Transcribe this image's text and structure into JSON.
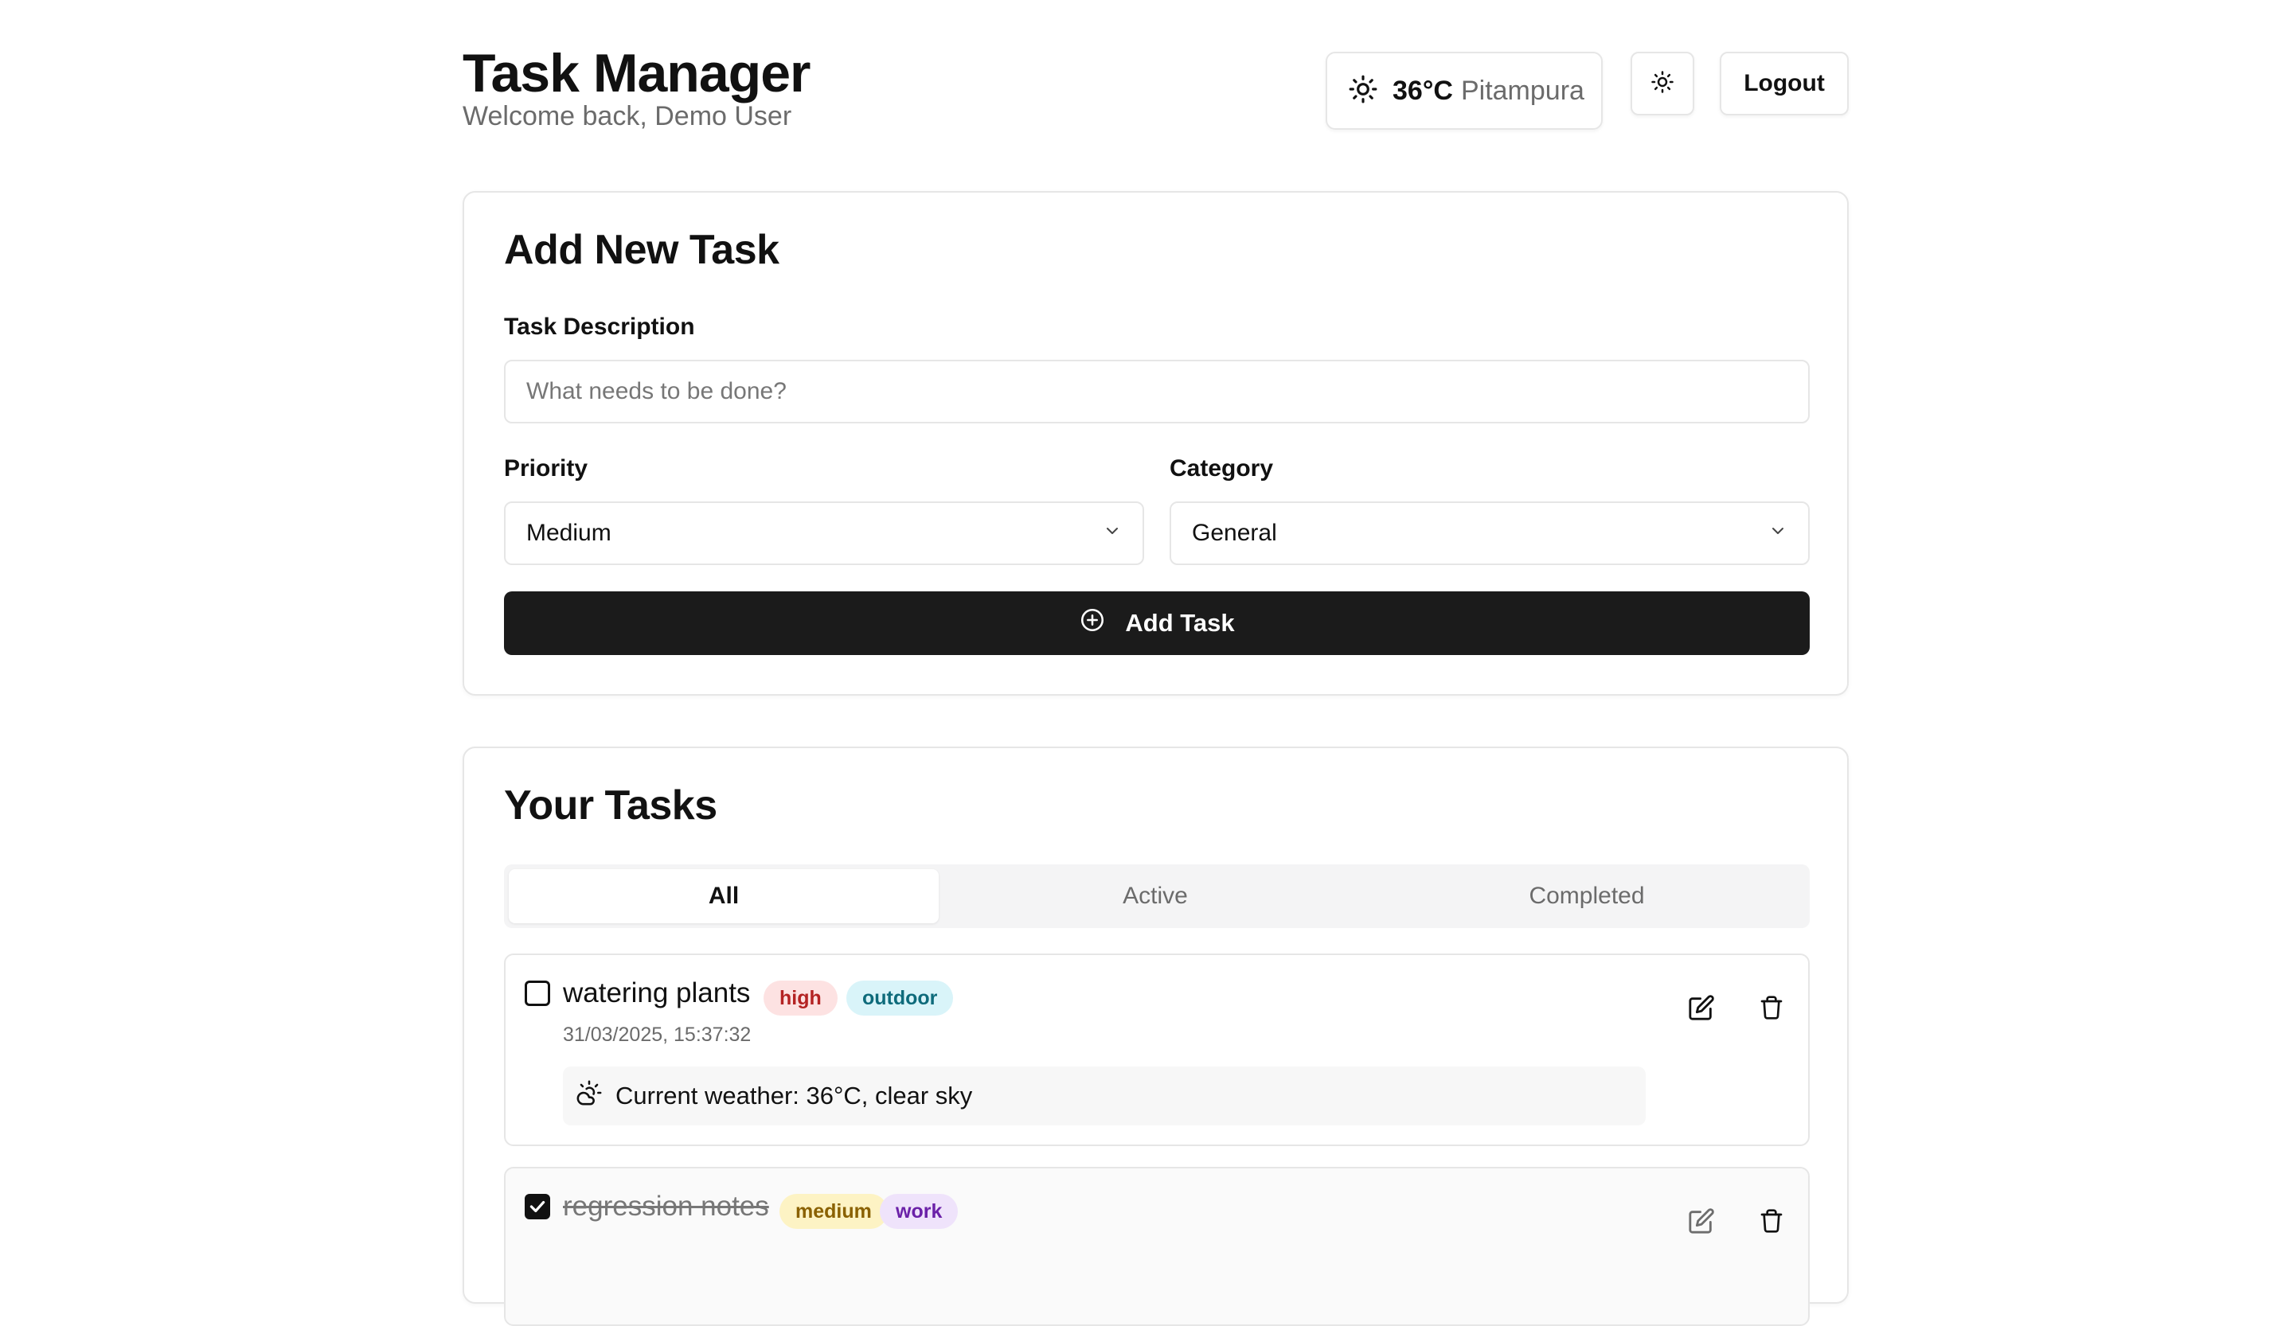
{
  "header": {
    "title": "Task Manager",
    "welcome": "Welcome back, Demo User",
    "weather": {
      "icon": "sun-icon",
      "temp": "36°C",
      "city": "Pitampura"
    },
    "theme_toggle_icon": "sun-icon",
    "logout_label": "Logout"
  },
  "add_task": {
    "title": "Add New Task",
    "description_label": "Task Description",
    "description_placeholder": "What needs to be done?",
    "description_value": "",
    "priority_label": "Priority",
    "priority_value": "Medium",
    "category_label": "Category",
    "category_value": "General",
    "submit_label": "Add Task",
    "submit_icon": "plus-circle-icon"
  },
  "tasks_section": {
    "title": "Your Tasks",
    "tabs": [
      {
        "label": "All",
        "active": true
      },
      {
        "label": "Active",
        "active": false
      },
      {
        "label": "Completed",
        "active": false
      }
    ],
    "items": [
      {
        "title": "watering plants",
        "completed": false,
        "priority": "high",
        "category": "outdoor",
        "timestamp": "31/03/2025, 15:37:32",
        "weather_note": "Current weather: 36°C, clear sky"
      },
      {
        "title": "regression notes",
        "completed": true,
        "priority": "medium",
        "category": "work"
      }
    ]
  },
  "colors": {
    "primary": "#1b1b1b",
    "border": "#e6e6e6",
    "badge_high_bg": "#fde2e2",
    "badge_high_fg": "#b42323",
    "badge_outdoor_bg": "#d9f4f9",
    "badge_outdoor_fg": "#0e6b7b",
    "badge_medium_bg": "#fdf3c4",
    "badge_medium_fg": "#8a6100",
    "badge_work_bg": "#efe3fb",
    "badge_work_fg": "#6b21a8"
  }
}
